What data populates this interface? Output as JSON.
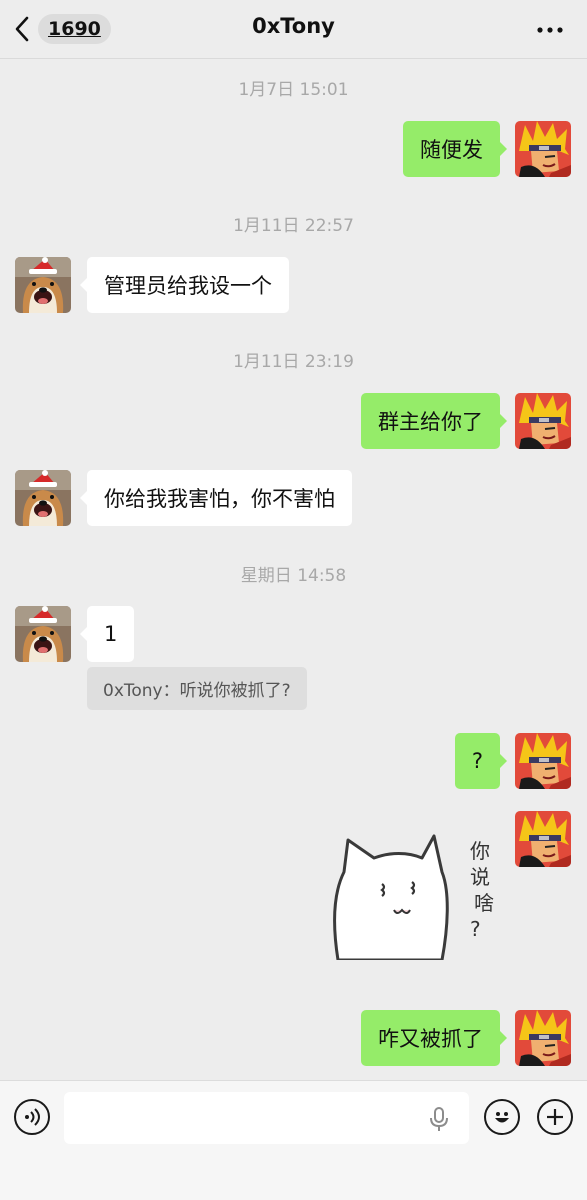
{
  "header": {
    "back_icon": "chevron-left-icon",
    "unread_count": "1690",
    "title": "0xTony",
    "more_icon": "more-dots-icon"
  },
  "messages": [
    {
      "type": "time",
      "text": "1月7日 15:01"
    },
    {
      "type": "out",
      "text": "随便发"
    },
    {
      "type": "time",
      "text": "1月11日 22:57"
    },
    {
      "type": "in",
      "text": "管理员给我设一个"
    },
    {
      "type": "time",
      "text": "1月11日 23:19"
    },
    {
      "type": "out",
      "text": "群主给你了"
    },
    {
      "type": "in",
      "text": "你给我我害怕，你不害怕"
    },
    {
      "type": "time",
      "text": "星期日 14:58"
    },
    {
      "type": "in",
      "text": "1",
      "quote": "0xTony：听说你被抓了?"
    },
    {
      "type": "out",
      "text": "?"
    },
    {
      "type": "out-sticker",
      "sticker": {
        "name": "white-cat-sticker",
        "text": [
          "你",
          "说",
          "啥",
          "?"
        ]
      }
    },
    {
      "type": "out",
      "text": "咋又被抓了"
    }
  ],
  "avatars": {
    "contact": "shiba-dog-santa-hat-avatar",
    "self": "naruto-avatar"
  },
  "input_bar": {
    "voice_icon": "voice-icon",
    "input_value": "",
    "mic_icon": "microphone-icon",
    "emoji_icon": "emoji-icon",
    "plus_icon": "plus-icon"
  },
  "colors": {
    "background": "#ededed",
    "outgoing_bubble": "#95ec69",
    "incoming_bubble": "#ffffff",
    "timestamp": "#a8a8a8"
  }
}
